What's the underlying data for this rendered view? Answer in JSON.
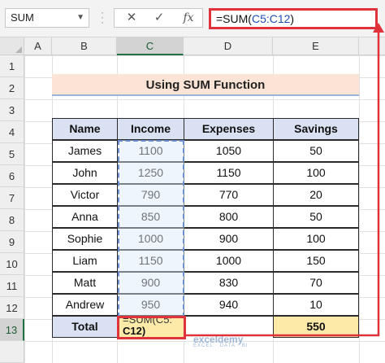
{
  "formula_bar": {
    "name_box": "SUM",
    "cancel_label": "✕",
    "enter_label": "✓",
    "fx_label": "fx",
    "formula_prefix": "=SUM(",
    "formula_ref": "C5:C12",
    "formula_suffix": ")"
  },
  "columns": [
    "A",
    "B",
    "C",
    "D",
    "E"
  ],
  "rows": [
    "1",
    "2",
    "3",
    "4",
    "5",
    "6",
    "7",
    "8",
    "9",
    "10",
    "11",
    "12",
    "13"
  ],
  "sheet_title": "Using SUM Function",
  "table": {
    "headers": [
      "Name",
      "Income",
      "Expenses",
      "Savings"
    ],
    "rows": [
      [
        "James",
        "1100",
        "1050",
        "50"
      ],
      [
        "John",
        "1250",
        "1150",
        "100"
      ],
      [
        "Victor",
        "790",
        "770",
        "20"
      ],
      [
        "Anna",
        "850",
        "800",
        "50"
      ],
      [
        "Sophie",
        "1000",
        "900",
        "100"
      ],
      [
        "Liam",
        "1150",
        "1000",
        "150"
      ],
      [
        "Matt",
        "900",
        "830",
        "70"
      ],
      [
        "Andrew",
        "950",
        "940",
        "10"
      ]
    ],
    "total_label": "Total",
    "total_formula_overflow": "=SUM(C5:",
    "total_formula_text": "C12)",
    "total_savings": "550"
  },
  "watermark": {
    "brand": "exceldemy",
    "tagline": "EXCEL · DATA · BI"
  },
  "colors": {
    "highlight_red": "#e0323a",
    "header_fill": "#d9e1f2",
    "total_fill": "#fde9a8",
    "title_fill": "#fbe3d6",
    "selected_header_green": "#217346"
  }
}
